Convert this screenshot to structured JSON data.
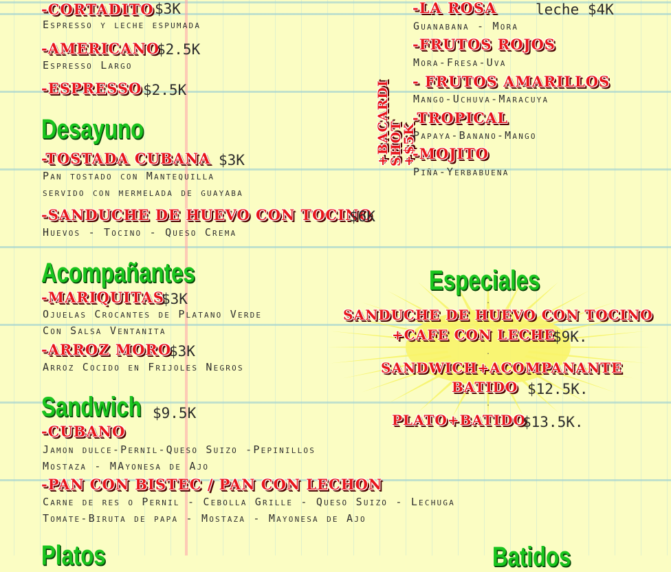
{
  "coffee": {
    "cortadito": {
      "name": "-CORTADITO",
      "price": "$3K",
      "desc": "Espresso y leche espumada"
    },
    "americano": {
      "name": "-AMERICANO",
      "price": "$2.5K",
      "desc": "Espresso Largo"
    },
    "espresso": {
      "name": "-ESPRESSO",
      "price": "$2.5K"
    }
  },
  "desayuno": {
    "title": "Desayuno",
    "tostada": {
      "name": "-TOSTADA CUBANA",
      "price": "$3K",
      "desc1": "Pan tostado con Mantequilla",
      "desc2": "servido con mermelada de guayaba"
    },
    "sanduche": {
      "name": "-SANDUCHE DE HUEVO CON TOCINO",
      "price": "$6K",
      "desc": "Huevos - Tocino - Queso Crema"
    }
  },
  "acompanantes": {
    "title": "Acompañantes",
    "mariquitas": {
      "name": "-MARIQUITAS",
      "price": "$3K",
      "desc1": "Ojuelas Crocantes de Platano Verde",
      "desc2": "Con Salsa Ventanita"
    },
    "arroz": {
      "name": "-ARROZ MORO",
      "price": "$3K",
      "desc": "Arroz Cocido en Frijoles Negros"
    }
  },
  "sandwich": {
    "title": "Sandwich",
    "price": "$9.5K",
    "cubano": {
      "name": "-CUBANO",
      "desc1": "Jamon dulce-Pernil-Queso Suizo -Pepinillos",
      "desc2": "Mostaza - MAyonesa de Ajo"
    },
    "pan": {
      "name": "-PAN CON BISTEC / PAN CON LECHON",
      "desc1": "Carne de res o Pernil - Cebolla Grille - Queso Suizo - Lechuga",
      "desc2": "Tomate-Biruta de papa - Mostaza - Mayonesa de Ajo"
    }
  },
  "platos_title": "Platos",
  "batidos_title": "Batidos",
  "drinks": {
    "vertical_label": "+BACARDI SHOT +$5K",
    "leche_price": "leche $4K",
    "la_rosa": {
      "name": "-LA ROSA",
      "desc": "Guanabana - Mora"
    },
    "frutos_rojos": {
      "name": "-FRUTOS ROJOS",
      "desc": "Mora-Fresa-Uva"
    },
    "frutos_amarillos": {
      "name": "- FRUTOS AMARILLOS",
      "desc": "Mango-Uchuva-Maracuya"
    },
    "tropical": {
      "name": "-TROPICAL",
      "desc": "Papaya-Banano-Mango"
    },
    "mojito": {
      "name": "-MOJITO",
      "desc": "Piña-Yerbabuena"
    }
  },
  "especiales": {
    "title": "Especiales",
    "combo1_line1": "SANDUCHE DE HUEVO CON TOCINO",
    "combo1_line2": "+CAFE CON LECHE",
    "combo1_price": "$9K.",
    "combo2_line1": "SANDWICH+ACOMPANANTE",
    "combo2_line2": "BATIDO",
    "combo2_price": "$12.5K.",
    "combo3_line1": "PLATO+BATIDO",
    "combo3_price": "$13.5K."
  },
  "colors": {
    "background": "#fbfdc3",
    "item_red": "#e8151b",
    "section_green": "#19c41e",
    "burst_yellow": "#f6f25a"
  }
}
